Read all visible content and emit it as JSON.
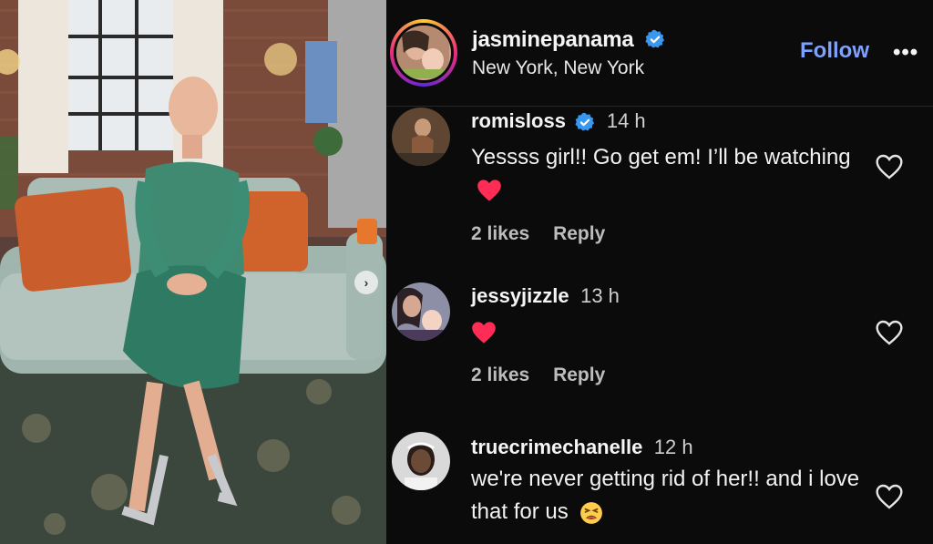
{
  "post": {
    "username": "jasminepanama",
    "location": "New York, New York",
    "follow_label": "Follow",
    "more_label": "•••"
  },
  "comments": [
    {
      "username": "romisloss",
      "time": "14 h",
      "text": "Yessss girl!! Go get em! I’ll be watching",
      "emoji": "red-heart",
      "likes": "2 likes",
      "reply": "Reply",
      "verified": true
    },
    {
      "username": "jessyjizzle",
      "time": "13 h",
      "text": "",
      "emoji": "red-heart",
      "likes": "2 likes",
      "reply": "Reply",
      "verified": false
    },
    {
      "username": "truecrimechanelle",
      "time": "12 h",
      "text": "we're never getting rid of her!! and i love that for us",
      "emoji": "tired-face",
      "likes": "",
      "reply": "",
      "verified": false
    }
  ],
  "carousel": {
    "next_label": "›"
  },
  "colors": {
    "background": "#0b0b0b",
    "follow": "#7ea1ff",
    "verified": "#3897f0",
    "heart": "#ff2d55"
  }
}
